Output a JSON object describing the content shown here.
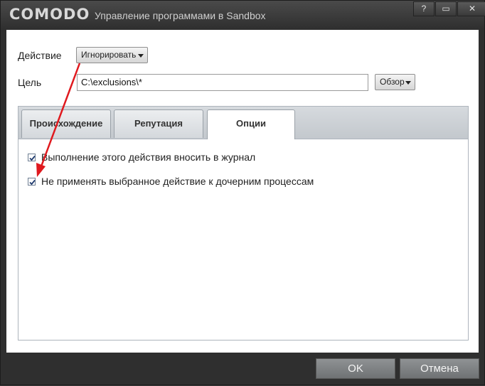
{
  "titlebar": {
    "logo": "COMODO",
    "title": "Управление программами в Sandbox",
    "help_glyph": "?",
    "maximize_glyph": "▭",
    "close_glyph": "✕"
  },
  "form": {
    "action_label": "Действие",
    "action_value": "Игнорировать",
    "target_label": "Цель",
    "target_value": "C:\\exclusions\\*",
    "browse_label": "Обзор"
  },
  "tabs": [
    {
      "label": "Происхождение"
    },
    {
      "label": "Репутация"
    },
    {
      "label": "Опции",
      "active": true
    }
  ],
  "options": [
    {
      "label": "Выполнение этого действия вносить в журнал",
      "checked": true
    },
    {
      "label": "Не применять выбранное действие к дочерним процессам",
      "checked": true
    }
  ],
  "footer": {
    "ok_label": "OK",
    "cancel_label": "Отмена"
  },
  "colors": {
    "annotation_arrow": "#e0191e",
    "checkmark": "#1f3b6f"
  }
}
